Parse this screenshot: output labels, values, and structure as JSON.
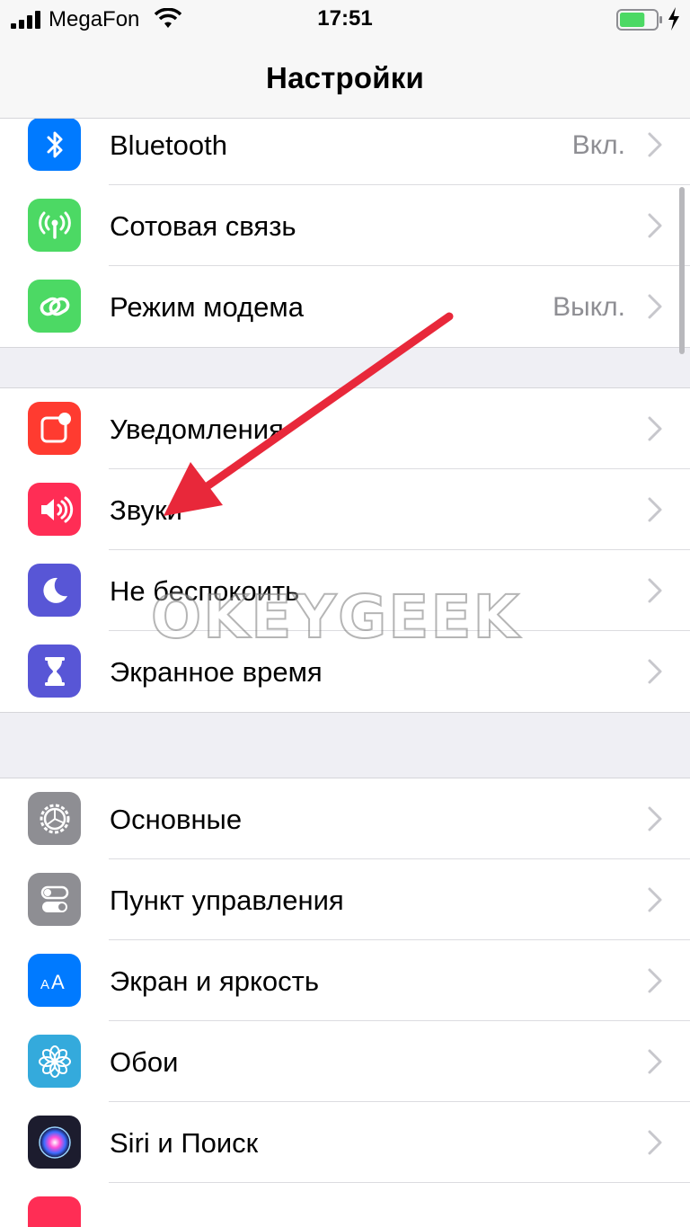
{
  "status_bar": {
    "carrier": "MegaFon",
    "time": "17:51",
    "battery_level": 0.7,
    "battery_color": "#4cd964"
  },
  "nav": {
    "title": "Настройки"
  },
  "watermark": "OKEYGEEK",
  "groups": [
    {
      "items": [
        {
          "label": "Bluetooth",
          "value": "Вкл.",
          "icon": "bluetooth-icon",
          "color": "#007aff"
        },
        {
          "label": "Сотовая связь",
          "value": "",
          "icon": "cellular-antenna-icon",
          "color": "#4cd964"
        },
        {
          "label": "Режим модема",
          "value": "Выкл.",
          "icon": "hotspot-chain-icon",
          "color": "#4cd964"
        }
      ]
    },
    {
      "items": [
        {
          "label": "Уведомления",
          "value": "",
          "icon": "notifications-icon",
          "color": "#ff3b30"
        },
        {
          "label": "Звуки",
          "value": "",
          "icon": "speaker-icon",
          "color": "#ff2d55"
        },
        {
          "label": "Не беспокоить",
          "value": "",
          "icon": "moon-icon",
          "color": "#5856d6"
        },
        {
          "label": "Экранное время",
          "value": "",
          "icon": "hourglass-icon",
          "color": "#5856d6"
        }
      ]
    },
    {
      "items": [
        {
          "label": "Основные",
          "value": "",
          "icon": "gear-icon",
          "color": "#8e8e93"
        },
        {
          "label": "Пункт управления",
          "value": "",
          "icon": "toggles-icon",
          "color": "#8e8e93"
        },
        {
          "label": "Экран и яркость",
          "value": "",
          "icon": "text-size-icon",
          "color": "#007aff"
        },
        {
          "label": "Обои",
          "value": "",
          "icon": "flower-icon",
          "color": "#34aadc"
        },
        {
          "label": "Siri и Поиск",
          "value": "",
          "icon": "siri-icon",
          "color": "#1c1c2e"
        }
      ]
    }
  ],
  "annotation": {
    "color": "#e8283a"
  }
}
